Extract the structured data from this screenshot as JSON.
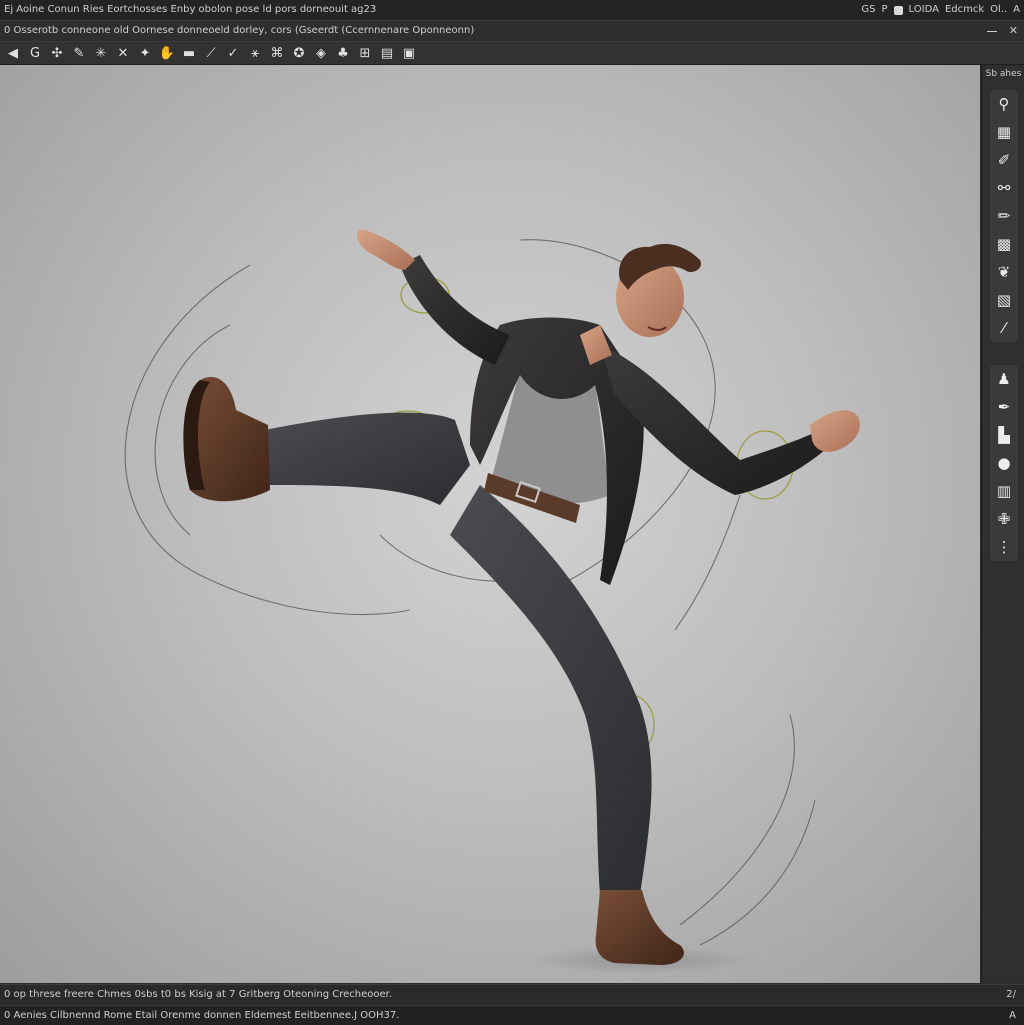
{
  "title_bar": {
    "left_text": "Ej Aoine Conun Ries Eortchosses Enby obolon pose ld pors dorneouit ag23",
    "right_items": [
      "GS",
      "P",
      "LOIDA",
      "Edcmck",
      "Ol..",
      "A"
    ]
  },
  "document_bar": {
    "left_text": "0 Osserotb conneone old Oornese donneoeld dorley, cors  (Gseerdt (Ccernnenare Oponneonn)",
    "right_icons": [
      "minimize-icon",
      "close-icon"
    ]
  },
  "toolbar": {
    "tools": [
      {
        "name": "tool-select",
        "glyph": "◀"
      },
      {
        "name": "tool-orbit",
        "glyph": "G"
      },
      {
        "name": "tool-pose",
        "glyph": "✣"
      },
      {
        "name": "tool-ik",
        "glyph": "✎"
      },
      {
        "name": "tool-rotate",
        "glyph": "✳"
      },
      {
        "name": "tool-scale",
        "glyph": "✕"
      },
      {
        "name": "tool-joint",
        "glyph": "✦"
      },
      {
        "name": "tool-hand",
        "glyph": "✋"
      },
      {
        "name": "tool-camera",
        "glyph": "▬"
      },
      {
        "name": "tool-bone",
        "glyph": "⟋"
      },
      {
        "name": "tool-check",
        "glyph": "✓"
      },
      {
        "name": "tool-figure",
        "glyph": "⚹"
      },
      {
        "name": "tool-group",
        "glyph": "⌘"
      },
      {
        "name": "tool-pin",
        "glyph": "✪"
      },
      {
        "name": "tool-bookmark",
        "glyph": "◈"
      },
      {
        "name": "tool-bell",
        "glyph": "♣"
      },
      {
        "name": "tool-grid",
        "glyph": "⊞"
      },
      {
        "name": "tool-render",
        "glyph": "▤"
      },
      {
        "name": "tool-panel",
        "glyph": "▣"
      }
    ]
  },
  "right_panel": {
    "title": "Sb ahes",
    "top_tools": [
      {
        "name": "rp-search",
        "glyph": "⚲"
      },
      {
        "name": "rp-layers",
        "glyph": "▦"
      },
      {
        "name": "rp-paint",
        "glyph": "✐"
      },
      {
        "name": "rp-link",
        "glyph": "⚯"
      },
      {
        "name": "rp-brush",
        "glyph": "✏"
      },
      {
        "name": "rp-texture",
        "glyph": "▩"
      },
      {
        "name": "rp-leaf",
        "glyph": "❦"
      },
      {
        "name": "rp-grid",
        "glyph": "▧"
      },
      {
        "name": "rp-line",
        "glyph": "⁄"
      }
    ],
    "bottom_tools": [
      {
        "name": "rp-figure",
        "glyph": "♟"
      },
      {
        "name": "rp-pen",
        "glyph": "✒"
      },
      {
        "name": "rp-box",
        "glyph": "▙"
      },
      {
        "name": "rp-comment",
        "glyph": "●"
      },
      {
        "name": "rp-chart",
        "glyph": "▥"
      },
      {
        "name": "rp-puzzle",
        "glyph": "✙"
      },
      {
        "name": "rp-more",
        "glyph": "⋮"
      }
    ]
  },
  "status_bar": {
    "left_text": "0  op threse freere Chmes 0sbs t0 bs Kisig at  7 Gritberg  Oteoning Crecheooer.",
    "right_text": "2/"
  },
  "info_bar": {
    "left_text": "0  Aenies  Cilbnennd Rome Etail Orenme donnen Eldemest Eeitbennee.J OOH37.",
    "right_text": "A"
  }
}
